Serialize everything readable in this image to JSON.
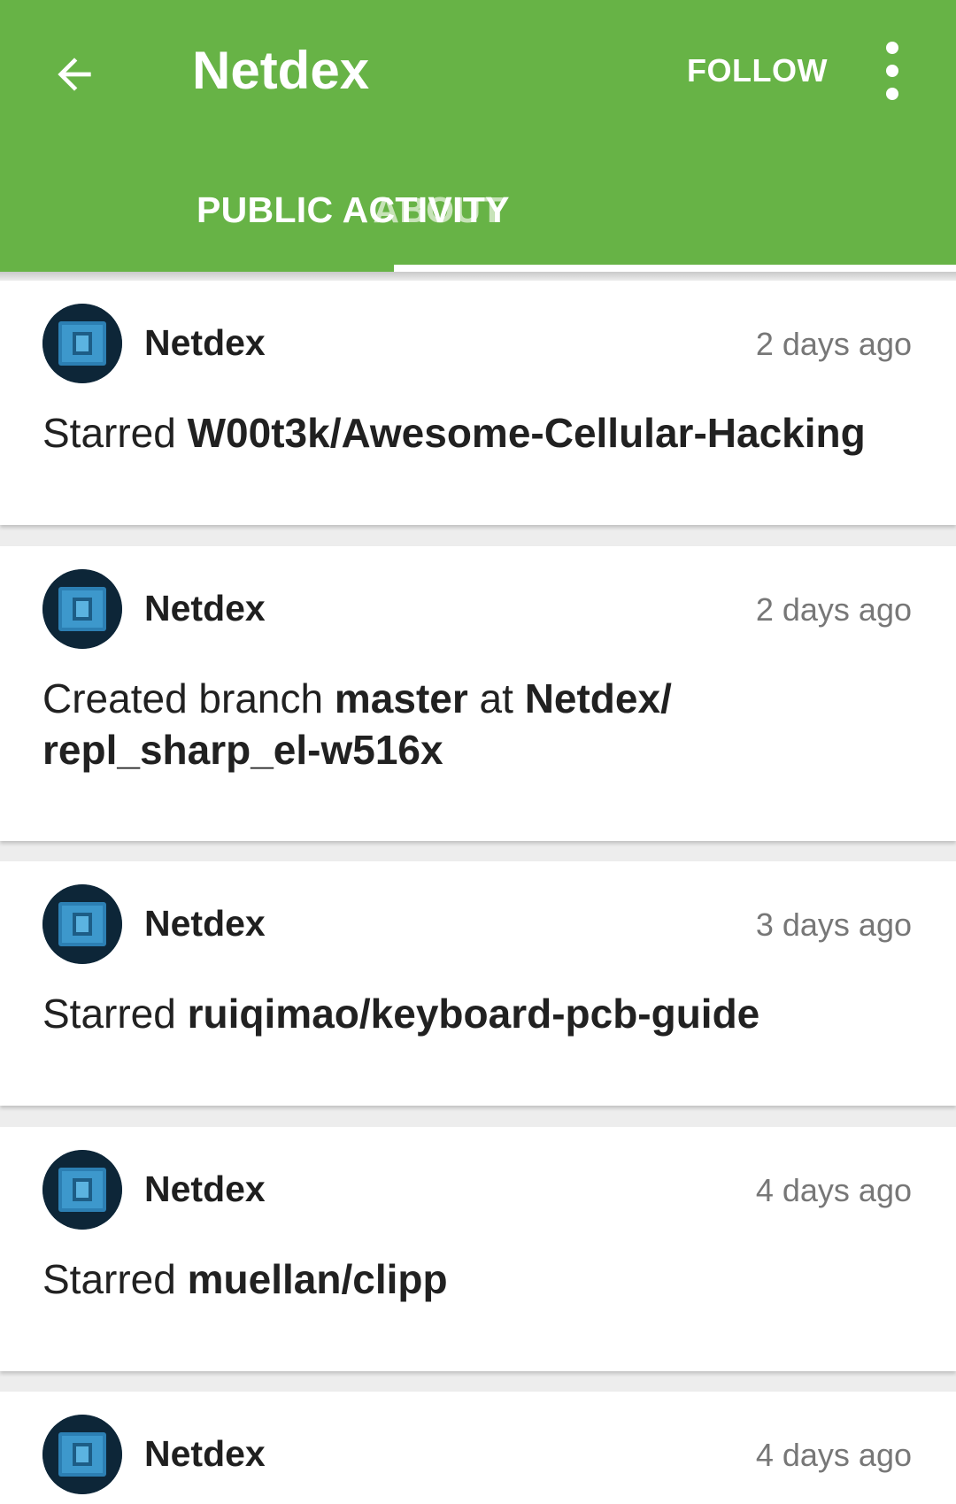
{
  "header": {
    "title": "Netdex",
    "follow_label": "FOLLOW",
    "back_icon": "arrow-left-icon",
    "more_icon": "more-vert-icon",
    "color": "#67b346"
  },
  "tabs": [
    {
      "label": "ABOUT",
      "selected": false
    },
    {
      "label": "PUBLIC ACTIVITY",
      "selected": true
    }
  ],
  "events": [
    {
      "user": "Netdex",
      "time": "2 days ago",
      "action": "Starred ",
      "repo": "W00t3k/Awesome-Cellular-Hacking"
    },
    {
      "user": "Netdex",
      "time": "2 days ago",
      "action": "Created branch ",
      "branch": "master",
      "connector": " at ",
      "repo": "Netdex/ repl_sharp_el-w516x"
    },
    {
      "user": "Netdex",
      "time": "3 days ago",
      "action": "Starred ",
      "repo": "ruiqimao/keyboard-pcb-guide"
    },
    {
      "user": "Netdex",
      "time": "4 days ago",
      "action": "Starred ",
      "repo": "muellan/clipp"
    },
    {
      "user": "Netdex",
      "time": "4 days ago"
    }
  ]
}
